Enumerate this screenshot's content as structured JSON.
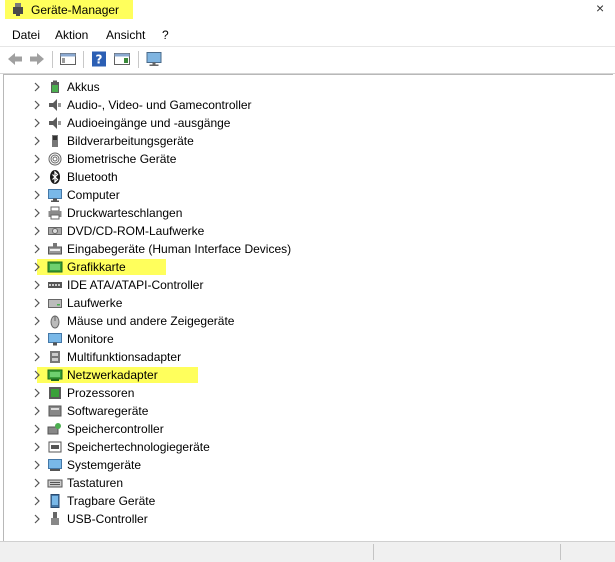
{
  "window": {
    "title": "Geräte-Manager",
    "close_glyph": "×",
    "highlight_color": "#ffff5c"
  },
  "menu": [
    "Datei",
    "Aktion",
    "Ansicht",
    "?"
  ],
  "toolbar": {
    "buttons": [
      "back-arrow-icon",
      "forward-arrow-icon",
      "properties-icon",
      "help-icon",
      "console-icon",
      "monitor-icon"
    ]
  },
  "tree": {
    "items": [
      {
        "label": "Akkus",
        "icon": "battery-icon"
      },
      {
        "label": "Audio-, Video- und Gamecontroller",
        "icon": "speaker-icon"
      },
      {
        "label": "Audioeingänge und -ausgänge",
        "icon": "speaker-icon"
      },
      {
        "label": "Bildverarbeitungsgeräte",
        "icon": "camera-icon"
      },
      {
        "label": "Biometrische Geräte",
        "icon": "fingerprint-icon"
      },
      {
        "label": "Bluetooth",
        "icon": "bluetooth-icon"
      },
      {
        "label": "Computer",
        "icon": "computer-icon"
      },
      {
        "label": "Druckwarteschlangen",
        "icon": "printer-icon"
      },
      {
        "label": "DVD/CD-ROM-Laufwerke",
        "icon": "disc-drive-icon"
      },
      {
        "label": "Eingabegeräte (Human Interface Devices)",
        "icon": "hid-icon"
      },
      {
        "label": "Grafikkarte",
        "icon": "graphics-card-icon",
        "highlighted": true
      },
      {
        "label": "IDE ATA/ATAPI-Controller",
        "icon": "ide-controller-icon"
      },
      {
        "label": "Laufwerke",
        "icon": "hard-drive-icon"
      },
      {
        "label": "Mäuse und andere Zeigegeräte",
        "icon": "mouse-icon"
      },
      {
        "label": "Monitore",
        "icon": "monitor-icon"
      },
      {
        "label": "Multifunktionsadapter",
        "icon": "multifunction-icon"
      },
      {
        "label": "Netzwerkadapter",
        "icon": "network-adapter-icon",
        "highlighted": true
      },
      {
        "label": "Prozessoren",
        "icon": "processor-icon"
      },
      {
        "label": "Softwaregeräte",
        "icon": "software-device-icon"
      },
      {
        "label": "Speichercontroller",
        "icon": "storage-controller-icon"
      },
      {
        "label": "Speichertechnologiegeräte",
        "icon": "storage-tech-icon"
      },
      {
        "label": "Systemgeräte",
        "icon": "system-device-icon"
      },
      {
        "label": "Tastaturen",
        "icon": "keyboard-icon"
      },
      {
        "label": "Tragbare Geräte",
        "icon": "portable-device-icon"
      },
      {
        "label": "USB-Controller",
        "icon": "usb-icon"
      }
    ]
  }
}
